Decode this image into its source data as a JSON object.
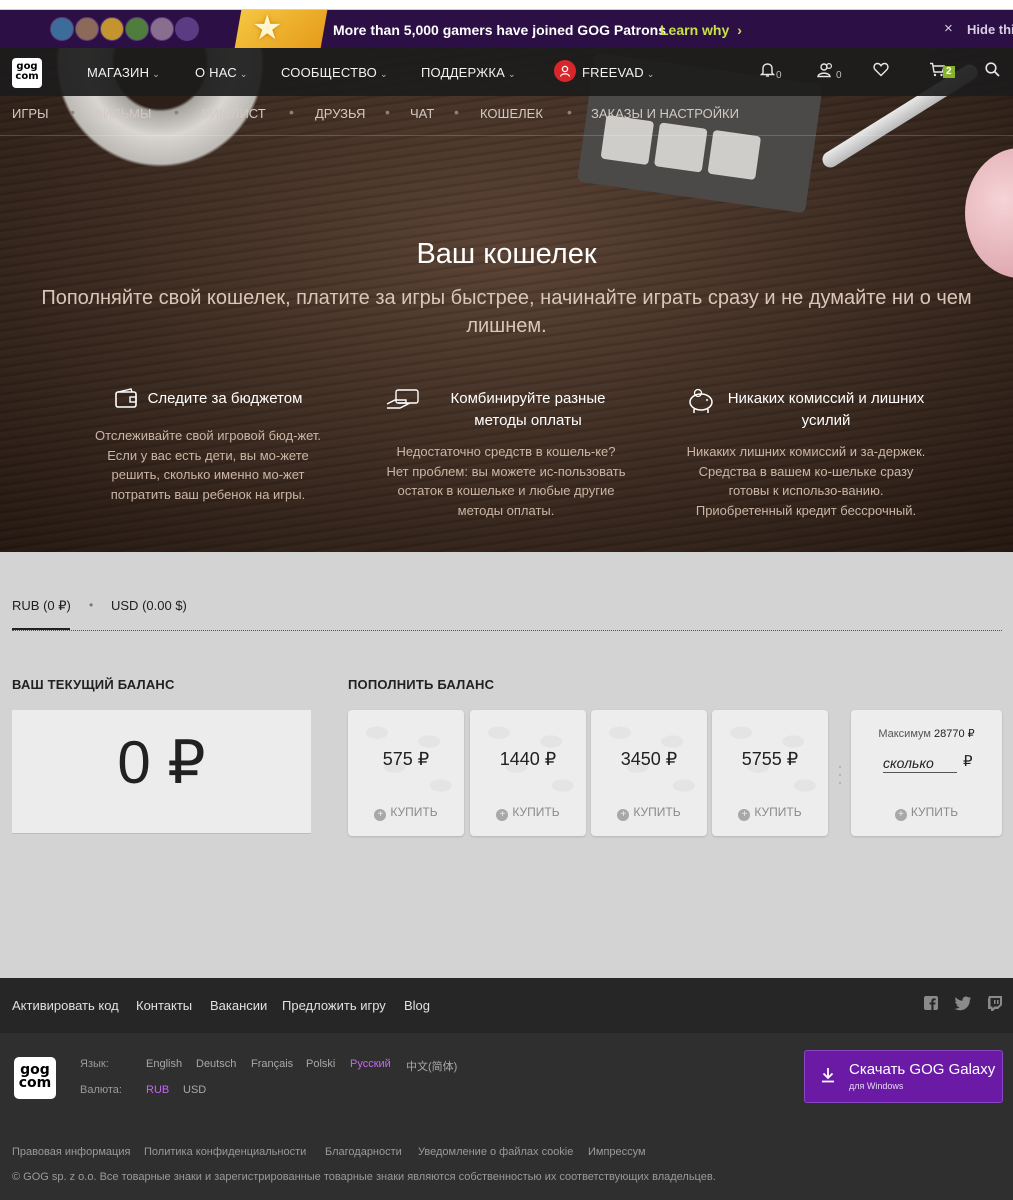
{
  "promo": {
    "text": "More than 5,000 gamers have joined GOG Patrons",
    "link": "Learn why",
    "link_arrow": "›",
    "close": "×",
    "hide": "Hide thi"
  },
  "nav": {
    "logo_top": "gog",
    "logo_bottom": "com",
    "store": "МАГАЗИН",
    "about": "О НАС",
    "community": "СООБЩЕСТВО",
    "support": "ПОДДЕРЖКА",
    "username": "FREEVAD",
    "notifications_count": "0",
    "friends_count": "0",
    "cart_count": "2"
  },
  "subnav": {
    "games": "ИГРЫ",
    "movies": "ФИЛЬМЫ",
    "wishlist": "ВИШЛИСТ",
    "friends": "ДРУЗЬЯ",
    "chat": "ЧАТ",
    "wallet": "КОШЕЛЕК",
    "orders": "ЗАКАЗЫ И НАСТРОЙКИ"
  },
  "hero": {
    "title": "Ваш кошелек",
    "subtitle": "Пополняйте свой кошелек, платите за игры быстрее, начинайте играть сразу и не думайте ни о чем лишнем."
  },
  "features": [
    {
      "icon": "wallet-icon",
      "title": "Следите за бюджетом",
      "text": "Отслеживайте свой игровой бюд-жет. Если у вас есть дети, вы мо-жете решить, сколько именно мо-жет потратить ваш ребенок на игры."
    },
    {
      "icon": "payment-hand-icon",
      "title": "Комбинируйте разные методы оплаты",
      "text": "Недостаточно средств в кошель-ке? Нет проблем:  вы можете ис-пользовать остаток в кошельке и любые другие методы оплаты."
    },
    {
      "icon": "piggy-bank-icon",
      "title": "Никаких комиссий и лишних усилий",
      "text": "Никаких лишних комиссий и за-держек. Средства в вашем ко-шельке сразу готовы к использо-ванию. Приобретенный кредит бессрочный."
    }
  ],
  "currency_tabs": {
    "rub_code": "RUB",
    "rub_amount": "(0 ₽)",
    "usd_code": "USD",
    "usd_amount": "(0.00 $)"
  },
  "balance": {
    "title": "ВАШ ТЕКУЩИЙ БАЛАНС",
    "value": "0 ₽"
  },
  "topup": {
    "title": "ПОПОЛНИТЬ БАЛАНС",
    "buy_label": "КУПИТЬ",
    "amounts": [
      "575 ₽",
      "1440 ₽",
      "3450 ₽",
      "5755 ₽"
    ],
    "max_label": "Максимум",
    "max_value": "28770 ₽",
    "custom_placeholder": "сколько",
    "custom_currency": "₽"
  },
  "footer": {
    "links": [
      "Активировать код",
      "Контакты",
      "Вакансии",
      "Предложить игру",
      "Blog"
    ],
    "language_label": "Язык:",
    "currency_label": "Валюта:",
    "languages": [
      "English",
      "Deutsch",
      "Français",
      "Polski",
      "Русский",
      "中文(简体)"
    ],
    "currencies": [
      "RUB",
      "USD"
    ],
    "galaxy_title": "Скачать GOG Galaxy",
    "galaxy_sub": "для Windows",
    "legal": [
      "Правовая информация",
      "Политика конфиденциальности",
      "Благодарности",
      "Уведомление о файлах cookie",
      "Импрессум"
    ],
    "copyright": "© GOG sp. z o.o. Все товарные знаки и зарегистрированные товарные знаки являются собственностью их соответствующих владельцев."
  },
  "colors": {
    "accent_purple": "#6b1aa6",
    "promo_link": "#c6e244",
    "cart_badge": "#86b22d",
    "active_option": "#c566f2"
  }
}
